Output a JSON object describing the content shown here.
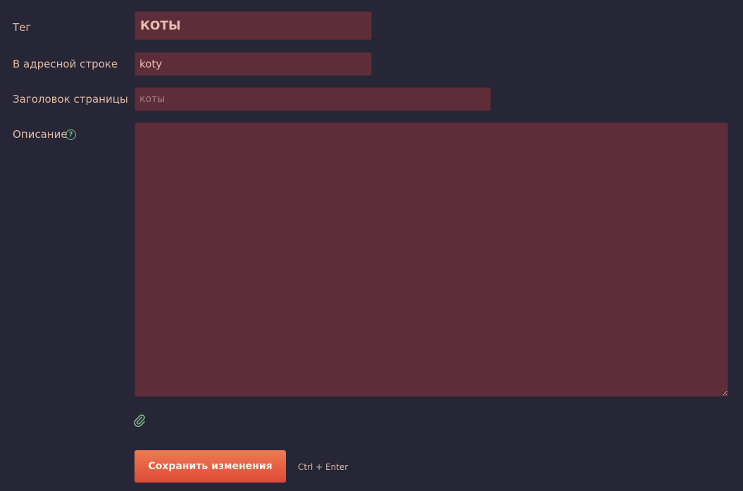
{
  "form": {
    "tag": {
      "label": "Тег",
      "value": "КОТЫ"
    },
    "slug": {
      "label": "В адресной строке",
      "value": "koty"
    },
    "page_title": {
      "label": "Заголовок страницы",
      "placeholder": "коты",
      "value": ""
    },
    "description": {
      "label": "Описание",
      "help_icon": "?",
      "value": ""
    },
    "attach_icon": "paperclip-icon",
    "save_label": "Сохранить изменения",
    "shortcut_hint": "Ctrl + Enter"
  },
  "colors": {
    "background": "#262636",
    "field_background": "#5e2d3a",
    "label_text": "#e2b9a3",
    "accent_green": "#7fc08c",
    "button_top": "#ef7a50",
    "button_bottom": "#dd4a37"
  }
}
